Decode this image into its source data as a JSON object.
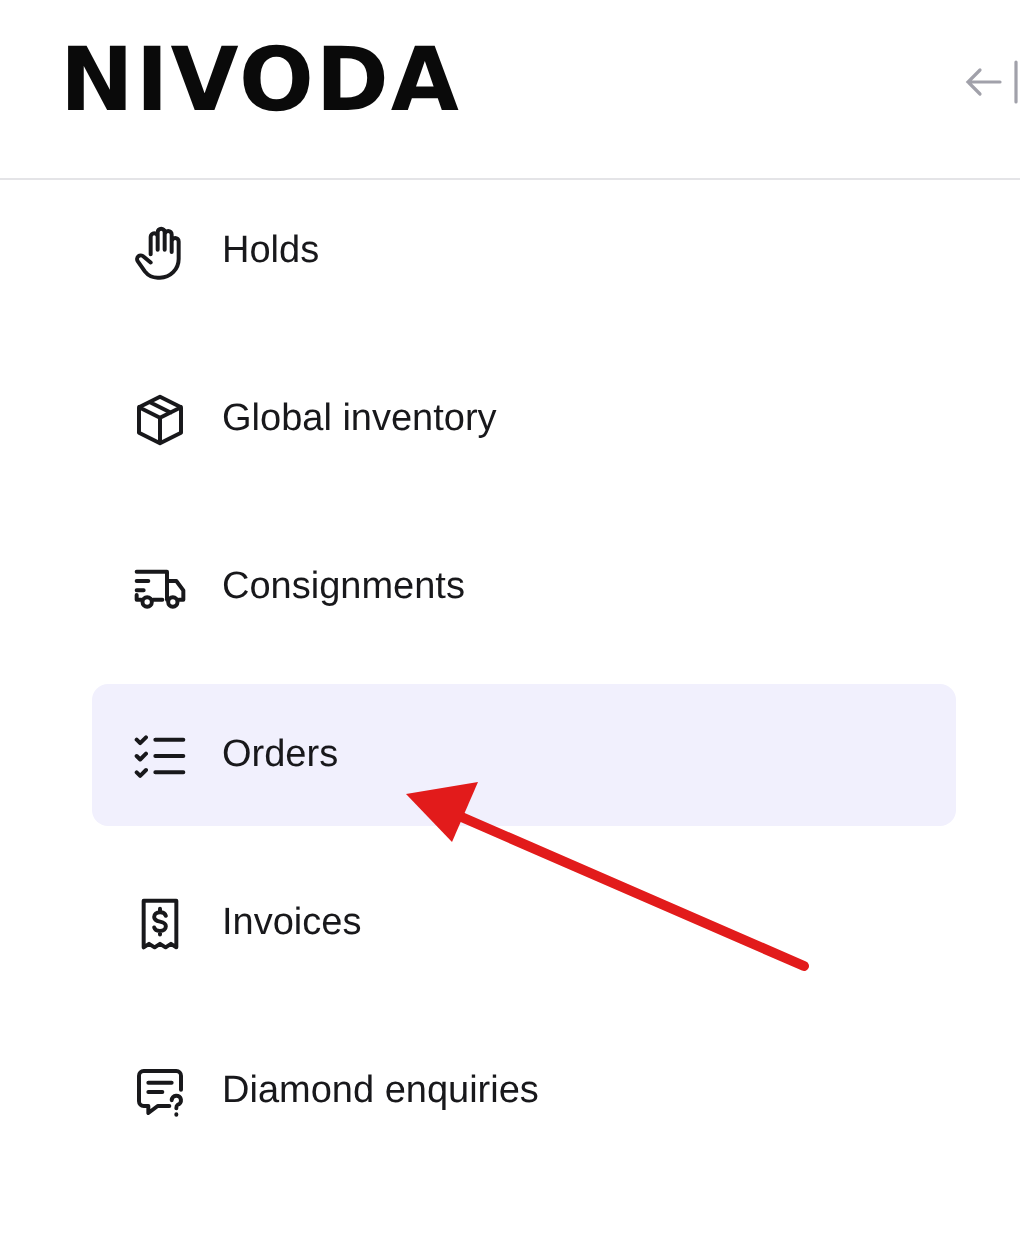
{
  "logo": "NIVODA",
  "nav_items": [
    {
      "label": "Holds",
      "selected": false
    },
    {
      "label": "Global inventory",
      "selected": false
    },
    {
      "label": "Consignments",
      "selected": false
    },
    {
      "label": "Orders",
      "selected": true
    },
    {
      "label": "Invoices",
      "selected": false
    },
    {
      "label": "Diamond enquiries",
      "selected": false
    }
  ]
}
